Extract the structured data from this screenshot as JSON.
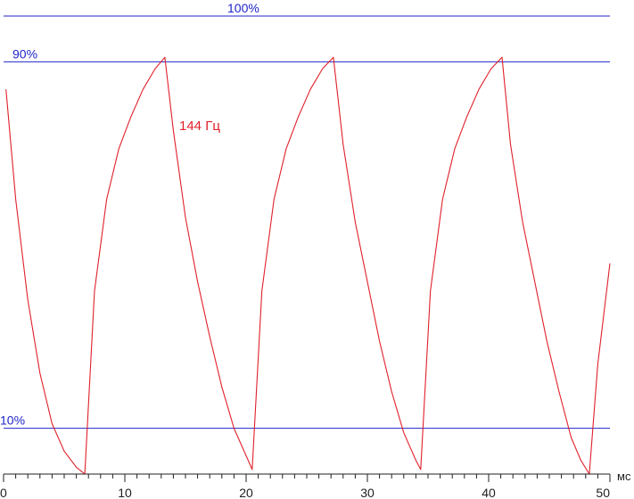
{
  "chart_data": {
    "type": "line",
    "x_unit": "мс",
    "xlim": [
      0,
      50
    ],
    "ylim": [
      0,
      100
    ],
    "x_ticks": [
      {
        "value": 0,
        "label": "0"
      },
      {
        "value": 10,
        "label": "10"
      },
      {
        "value": 20,
        "label": "20"
      },
      {
        "value": 30,
        "label": "30"
      },
      {
        "value": 40,
        "label": "40"
      },
      {
        "value": 50,
        "label": "50"
      }
    ],
    "reference_lines": [
      {
        "value": 100,
        "label": "100%"
      },
      {
        "value": 90,
        "label": "90%"
      },
      {
        "value": 10,
        "label": "10%"
      }
    ],
    "series": [
      {
        "name": "144 Гц",
        "color": "#e0202a",
        "points": [
          [
            0.2,
            84
          ],
          [
            1.0,
            60
          ],
          [
            2.0,
            38
          ],
          [
            3.0,
            22
          ],
          [
            4.0,
            11
          ],
          [
            5.0,
            5
          ],
          [
            6.0,
            1.5
          ],
          [
            6.7,
            0
          ],
          [
            7.5,
            40
          ],
          [
            8.5,
            60
          ],
          [
            9.5,
            71
          ],
          [
            10.5,
            78
          ],
          [
            11.5,
            84
          ],
          [
            12.5,
            88.5
          ],
          [
            13.3,
            91
          ],
          [
            14.0,
            75
          ],
          [
            15.0,
            56
          ],
          [
            16.0,
            42
          ],
          [
            17.0,
            30
          ],
          [
            18.0,
            19
          ],
          [
            19.0,
            10
          ],
          [
            20.0,
            4
          ],
          [
            20.5,
            1
          ],
          [
            21.3,
            40
          ],
          [
            22.3,
            60
          ],
          [
            23.3,
            71
          ],
          [
            24.3,
            78
          ],
          [
            25.3,
            84
          ],
          [
            26.3,
            88.5
          ],
          [
            27.2,
            91
          ],
          [
            28.0,
            72
          ],
          [
            29.0,
            55
          ],
          [
            30.0,
            42
          ],
          [
            31.0,
            29
          ],
          [
            32.0,
            18
          ],
          [
            33.0,
            9
          ],
          [
            34.0,
            3
          ],
          [
            34.4,
            1
          ],
          [
            35.2,
            40
          ],
          [
            36.2,
            60
          ],
          [
            37.2,
            71
          ],
          [
            38.2,
            78
          ],
          [
            39.2,
            84
          ],
          [
            40.2,
            88.5
          ],
          [
            41.1,
            91
          ],
          [
            41.8,
            72
          ],
          [
            42.8,
            55
          ],
          [
            43.8,
            42
          ],
          [
            44.8,
            29
          ],
          [
            45.8,
            18
          ],
          [
            46.8,
            8
          ],
          [
            47.6,
            3
          ],
          [
            48.3,
            0
          ],
          [
            49.0,
            24
          ],
          [
            50.0,
            46
          ]
        ]
      }
    ]
  }
}
